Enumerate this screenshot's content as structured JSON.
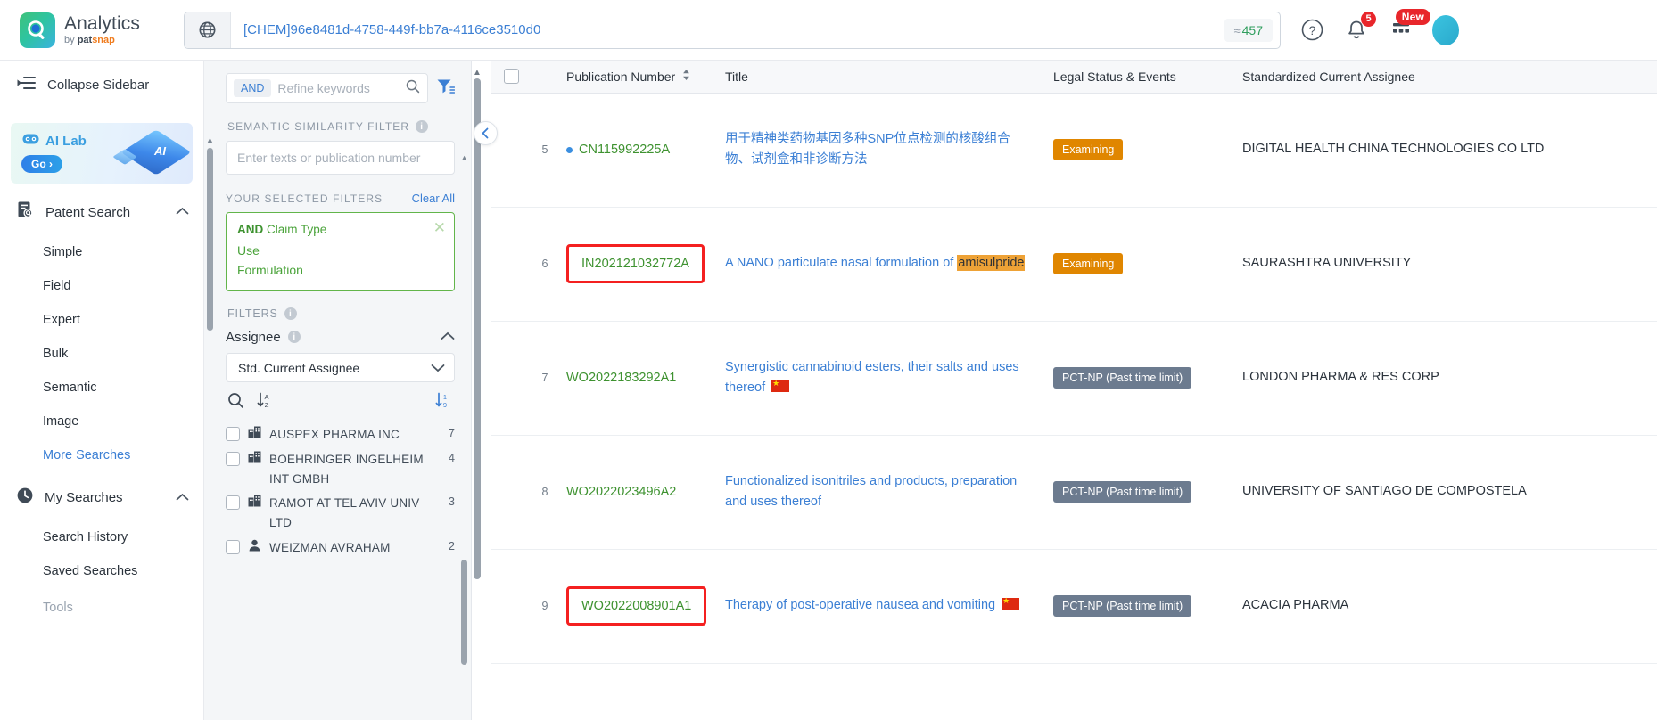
{
  "header": {
    "logo_title": "Analytics",
    "logo_by": "by",
    "logo_brand_a": "pat",
    "logo_brand_b": "snap",
    "search_query": "[CHEM]96e8481d-4758-449f-bb7a-4116ce3510d0",
    "result_approx_symbol": "≈",
    "result_count": "457",
    "icons": {
      "globe": "globe-icon",
      "help": "help-circle-icon",
      "notifications": "bell-icon",
      "notifications_badge": "5",
      "apps": "grid-apps-icon",
      "apps_badge": "New",
      "avatar": "user-avatar"
    }
  },
  "sidebar": {
    "collapse_label": "Collapse Sidebar",
    "ai_lab": {
      "title": "AI Lab",
      "cta": "Go ›",
      "cube_label": "AI"
    },
    "groups": [
      {
        "label": "Patent Search",
        "items": [
          {
            "label": "Simple"
          },
          {
            "label": "Field"
          },
          {
            "label": "Expert"
          },
          {
            "label": "Bulk"
          },
          {
            "label": "Semantic"
          },
          {
            "label": "Image"
          },
          {
            "label": "More Searches"
          }
        ]
      },
      {
        "label": "My Searches",
        "items": [
          {
            "label": "Search History"
          },
          {
            "label": "Saved Searches"
          }
        ]
      }
    ],
    "cut_off_item": "Tools"
  },
  "filters": {
    "refine": {
      "operator": "AND",
      "placeholder": "Refine keywords"
    },
    "semantic": {
      "label": "SEMANTIC SIMILARITY FILTER",
      "placeholder": "Enter texts or publication number"
    },
    "selected": {
      "label": "YOUR SELECTED FILTERS",
      "clear_all": "Clear All",
      "card": {
        "operator": "AND",
        "field": "Claim Type",
        "values": [
          "Use",
          "Formulation"
        ]
      }
    },
    "filters_label": "FILTERS",
    "assignee": {
      "title": "Assignee",
      "select_value": "Std. Current Assignee",
      "items": [
        {
          "name": "AUSPEX PHARMA INC",
          "count": "7",
          "type": "company"
        },
        {
          "name": "BOEHRINGER INGELHEIM INT GMBH",
          "count": "4",
          "type": "company"
        },
        {
          "name": "RAMOT AT TEL AVIV UNIV LTD",
          "count": "3",
          "type": "company"
        },
        {
          "name": "WEIZMAN AVRAHAM",
          "count": "2",
          "type": "person"
        }
      ]
    }
  },
  "table": {
    "columns": [
      {
        "key": "checkbox",
        "label": ""
      },
      {
        "key": "index",
        "label": ""
      },
      {
        "key": "publication_number",
        "label": "Publication Number",
        "sortable": true
      },
      {
        "key": "title",
        "label": "Title"
      },
      {
        "key": "legal_status",
        "label": "Legal Status & Events"
      },
      {
        "key": "assignee",
        "label": "Standardized Current Assignee"
      }
    ],
    "rows": [
      {
        "index": "5",
        "publication_number": "CN115992225A",
        "has_dot": true,
        "highlighted": false,
        "title": "用于精神类药物基因多种SNP位点检测的核酸组合物、试剂盒和非诊断方法",
        "title_highlight": "",
        "title_flag": false,
        "legal_status": "Examining",
        "legal_status_kind": "examining",
        "assignee": "DIGITAL HEALTH CHINA TECHNOLOGIES CO LTD"
      },
      {
        "index": "6",
        "publication_number": "IN202121032772A",
        "has_dot": false,
        "highlighted": true,
        "title": "A NANO particulate nasal formulation of ",
        "title_highlight": "amisulpride",
        "title_flag": false,
        "legal_status": "Examining",
        "legal_status_kind": "examining",
        "assignee": "SAURASHTRA UNIVERSITY"
      },
      {
        "index": "7",
        "publication_number": "WO2022183292A1",
        "has_dot": false,
        "highlighted": false,
        "title": "Synergistic cannabinoid esters, their salts and uses thereof ",
        "title_highlight": "",
        "title_flag": true,
        "legal_status": "PCT-NP (Past time limit)",
        "legal_status_kind": "pct",
        "assignee": "LONDON PHARMA & RES CORP"
      },
      {
        "index": "8",
        "publication_number": "WO2022023496A2",
        "has_dot": false,
        "highlighted": false,
        "title": "Functionalized isonitriles and products, preparation and uses thereof",
        "title_highlight": "",
        "title_flag": false,
        "legal_status": "PCT-NP (Past time limit)",
        "legal_status_kind": "pct",
        "assignee": "UNIVERSITY OF SANTIAGO DE COMPOSTELA"
      },
      {
        "index": "9",
        "publication_number": "WO2022008901A1",
        "has_dot": false,
        "highlighted": true,
        "title": "Therapy of post-operative nausea and vomiting ",
        "title_highlight": "",
        "title_flag": true,
        "legal_status": "PCT-NP (Past time limit)",
        "legal_status_kind": "pct",
        "assignee": "ACACIA PHARMA"
      }
    ]
  },
  "colors": {
    "accent_blue": "#3b7fd4",
    "green": "#3e9230",
    "orange_badge": "#e08600",
    "slate_badge": "#6c7b8f",
    "highlight_box": "#f42020",
    "term_highlight": "#eea236"
  }
}
